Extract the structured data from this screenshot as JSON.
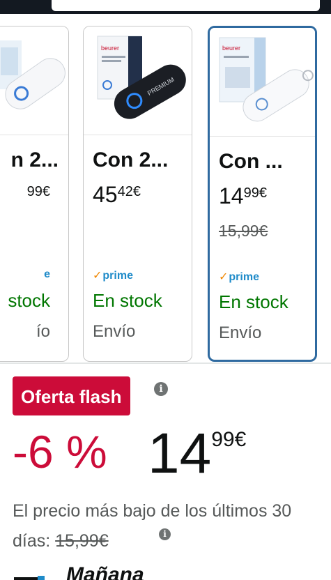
{
  "carousel": {
    "cards": [
      {
        "title": "n 2...",
        "price_whole": "",
        "price_frac": "99€",
        "old_price": "",
        "prime_label": "e",
        "stock": "stock",
        "shipping": "ío",
        "selected": false
      },
      {
        "title": "Con 2...",
        "price_whole": "45",
        "price_frac": "42€",
        "old_price": "",
        "prime_label": "prime",
        "stock": "En stock",
        "shipping": "Envío",
        "selected": false
      },
      {
        "title": "Con ...",
        "price_whole": "14",
        "price_frac": "99€",
        "old_price": "15,99€",
        "prime_label": "prime",
        "stock": "En stock",
        "shipping": "Envío",
        "selected": true
      }
    ],
    "brand_text": "beurer",
    "premium_text": "PREMIUM"
  },
  "deal": {
    "badge": "Oferta flash",
    "discount": "-6 %",
    "price_whole": "14",
    "price_frac": "99€",
    "lowest_text": "El precio más bajo de los últimos 30 días: ",
    "lowest_price": "15,99€",
    "info_icon": "i"
  },
  "delivery": {
    "label": "Mañana"
  },
  "colors": {
    "deal_red": "#cc0c39",
    "stock_green": "#007600",
    "prime_blue": "#1f8bc9",
    "prime_check": "#f08804",
    "selected_border": "#2f6aa0"
  }
}
